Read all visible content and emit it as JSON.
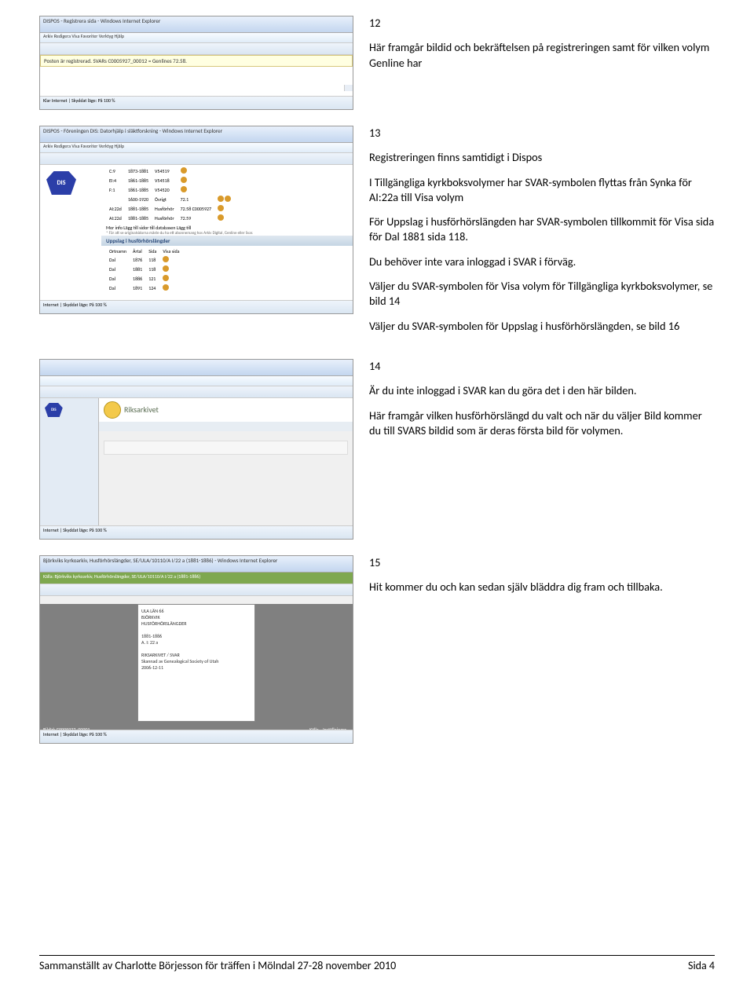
{
  "block12": {
    "num": "12",
    "p1": "Här framgår bildid och bekräftelsen på registreringen samt för vilken volym Genline har",
    "thumb_title": "DISPOS - Registrera sida - Windows Internet Explorer",
    "thumb_yellow": "Posten är registrerad. SVARs C0005927_00012 = Genlines 72.58.",
    "thumb_menu": "Arkiv  Redigera  Visa  Favoriter  Verktyg  Hjälp",
    "status": "Klar          Internet | Skyddat läge: På          100 %"
  },
  "block13": {
    "num": "13",
    "p1": "Registreringen finns samtidigt i Dispos",
    "p2": "I Tillgängliga kyrkboksvolymer har SVAR-symbolen flyttas från Synka för AI:22a till Visa volym",
    "p3": "För Uppslag i husförhörslängden har SVAR-symbolen tillkommit för Visa sida för Dal 1881 sida 118.",
    "p4": "Du behöver inte vara inloggad i SVAR i förväg.",
    "p5": "Väljer du SVAR-symbolen för Visa volym för Tillgängliga kyrkboksvolymer, se bild 14",
    "p6": "Väljer du SVAR-symbolen för Uppslag i husförhörslängden, se bild 16",
    "thumb_title": "DISPOS - Föreningen DIS: Datorhjälp i släktforskning - Windows Internet Explorer",
    "thumb_menu": "Arkiv  Redigera  Visa  Favoriter  Verktyg  Hjälp",
    "badge": "DIS",
    "tbl": {
      "rows": [
        [
          "C:9",
          "1873-1881",
          "V54519",
          "",
          ""
        ],
        [
          "EI:4",
          "1861-1885",
          "V54518",
          "",
          ""
        ],
        [
          "F:1",
          "1861-1885",
          "V54520",
          "",
          ""
        ],
        [
          "",
          "1600-1920",
          "Övrigt",
          "72.1",
          ""
        ],
        [
          "AI:22d",
          "1881-1885",
          "Husförhör",
          "72.58 C0005927",
          ""
        ],
        [
          "AI:22d",
          "1881-1885",
          "Husförhör",
          "72.59",
          ""
        ]
      ],
      "merinfo": "Mer info    Lägg till sidor till databasen        Lägg till",
      "footnote": "* För att se originalsidorna måste du ha ett abonnemang hos Arkiv Digital, Genline eller Svar."
    },
    "tbl2": {
      "h": "Uppslag i husförhörslängder",
      "cols": [
        "Ortnamn",
        "Årtal",
        "Sida",
        "Visa sida"
      ],
      "rows": [
        [
          "Dal",
          "1876",
          "118",
          ""
        ],
        [
          "Dal",
          "1881",
          "118",
          ""
        ],
        [
          "Dal",
          "1886",
          "121",
          ""
        ],
        [
          "Dal",
          "1891",
          "124",
          ""
        ]
      ]
    },
    "status": "Internet | Skyddat läge: På          100 %"
  },
  "block14": {
    "num": "14",
    "p1": "Är du inte inloggad i SVAR kan du göra det i den här bilden.",
    "p2": "Här framgår vilken husförhörslängd du valt och när du väljer Bild kommer du till SVARS bildid som är deras första bild för volymen.",
    "rtext": "Riksarkivet",
    "status": "Internet | Skyddat läge: På          100 %"
  },
  "block15": {
    "num": "15",
    "p1": "Hit kommer du och kan sedan själv bläddra dig fram och tillbaka.",
    "thumb_title": "Björkviks kyrkoarkiv, Husförhörslängder, SE/ULA/10110/A I/22 a (1881-1886) - Windows Internet Explorer",
    "kalla": "Källa: Björkviks kyrkoarkiv, Husförhörslängder, SE/ULA/10110/A I/22 a (1881-1886)",
    "bildid": "BildId: C0005927_00001",
    "doc": "ULA   LÄN 66\nBJÖRKVIK\nHUSFÖRHÖRSLÄNGDER\n\n1881-1886\nA. I: 22 a\n\nRIKSARKIVET / SVAR\nSkannad av Genealogical Society of Utah\n2006-12-11",
    "status": "Internet | Skyddat läge: På          100 %",
    "kalla_label": "Källa",
    "install": "Inställningar"
  },
  "footer": {
    "left": "Sammanställt av Charlotte Börjesson för träffen i Mölndal 27-28 november 2010",
    "right": "Sida 4"
  }
}
